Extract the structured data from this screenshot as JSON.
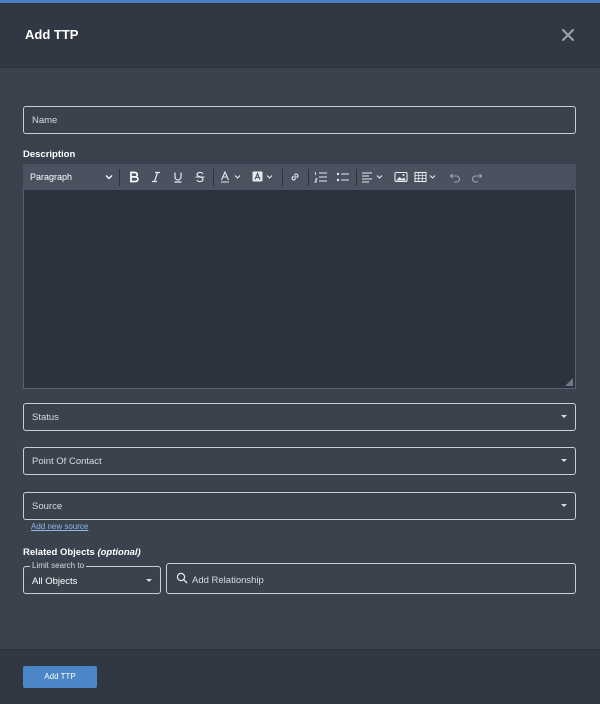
{
  "modal": {
    "title": "Add TTP"
  },
  "form": {
    "name_placeholder": "Name",
    "description_label": "Description",
    "status_placeholder": "Status",
    "point_of_contact_placeholder": "Point Of Contact",
    "source_placeholder": "Source",
    "add_new_source_link": "Add new source"
  },
  "editor": {
    "paragraph_select": "Paragraph",
    "toolbar_icons": [
      "bold-icon",
      "italic-icon",
      "underline-icon",
      "strikethrough-icon",
      "font-color-icon",
      "highlight-icon",
      "link-icon",
      "numbered-list-icon",
      "bulleted-list-icon",
      "align-icon",
      "image-icon",
      "table-icon",
      "undo-icon",
      "redo-icon"
    ]
  },
  "related": {
    "label": "Related Objects",
    "optional": "(optional)",
    "limit_legend": "Limit search to",
    "limit_value": "All Objects",
    "relationship_placeholder": "Add Relationship"
  },
  "footer": {
    "add_button": "Add TTP"
  },
  "colors": {
    "accent": "#4b86c7",
    "modal_bg": "#3a424e",
    "header_bg": "#313843",
    "editor_bg": "#2d333e",
    "toolbar_bg": "#4a5260"
  }
}
